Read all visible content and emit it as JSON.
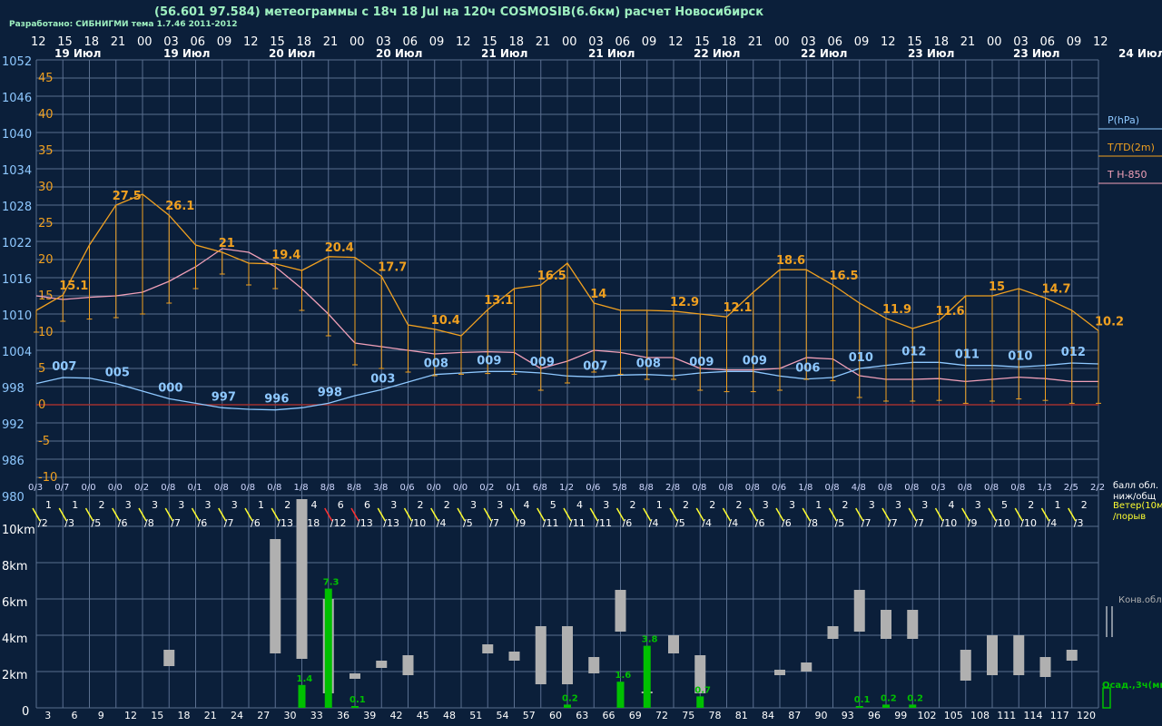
{
  "header": {
    "title": "(56.601 97.584) метеограммы с  18ч 18 Jul на 120ч COSMOSIB(6.6км) расчет Новосибирск",
    "credits": "Разработано: СИБНИГМИ тема 1.7.46 2011-2012"
  },
  "colors": {
    "pressure": "#8ec8ff",
    "temp": "#f0a020",
    "td": "#f0a0b8",
    "grid": "#5a6f8f",
    "precip": "#00c000",
    "cloud": "#b0b0b0",
    "wind": "#ffff30"
  },
  "chart_data": [
    {
      "type": "line",
      "title": "",
      "time_hours": [
        "12",
        "15",
        "18",
        "21",
        "00",
        "03",
        "06",
        "09",
        "12",
        "15",
        "18",
        "21",
        "00",
        "03",
        "06",
        "09",
        "12",
        "15",
        "18",
        "21",
        "00",
        "03",
        "06",
        "09",
        "12",
        "15",
        "18",
        "21",
        "00",
        "03",
        "06",
        "09",
        "12",
        "15",
        "18",
        "21",
        "00",
        "03",
        "06",
        "09",
        "12",
        "15",
        "18",
        "21",
        "00",
        "03",
        "06",
        "09",
        "12",
        "15",
        "18",
        "21",
        "00",
        "03",
        "06",
        "09",
        "12"
      ],
      "date_labels": [
        "19 Июл",
        "19 Июл",
        "20 Июл",
        "20 Июл",
        "21 Июл",
        "21 Июл",
        "22 Июл",
        "22 Июл",
        "23 Июл",
        "23 Июл",
        "24 Июл"
      ],
      "pressure_ticks": [
        "1052",
        "1046",
        "1040",
        "1034",
        "1028",
        "1022",
        "1016",
        "1010",
        "1004",
        "998",
        "992",
        "986",
        "980"
      ],
      "temp_ticks": [
        "45",
        "40",
        "35",
        "30",
        "25",
        "20",
        "15",
        "10",
        "5",
        "0",
        "-5",
        "-10"
      ],
      "legend": [
        "P(hPa)",
        "T/TD(2m)",
        "T H-850"
      ],
      "temp_ylim": [
        -10,
        45
      ],
      "pressure_ylim": [
        980,
        1052
      ],
      "temperature_points": [
        {
          "step": 0,
          "value": "",
          "t": 13
        },
        {
          "step": 1,
          "value": "15.1",
          "t": 15.1
        },
        {
          "step": 2,
          "value": "",
          "t": 22
        },
        {
          "step": 3,
          "value": "27.5",
          "t": 27.5
        },
        {
          "step": 4,
          "value": "",
          "t": 29
        },
        {
          "step": 5,
          "value": "26.1",
          "t": 26.1
        },
        {
          "step": 6,
          "value": "",
          "t": 22
        },
        {
          "step": 7,
          "value": "21",
          "t": 21
        },
        {
          "step": 8,
          "value": "",
          "t": 19.5
        },
        {
          "step": 9,
          "value": "19.4",
          "t": 19.4
        },
        {
          "step": 10,
          "value": "",
          "t": 18.5
        },
        {
          "step": 11,
          "value": "20.4",
          "t": 20.4
        },
        {
          "step": 12,
          "value": "",
          "t": 20.3
        },
        {
          "step": 13,
          "value": "17.7",
          "t": 17.7
        },
        {
          "step": 14,
          "value": "",
          "t": 11
        },
        {
          "step": 15,
          "value": "10.4",
          "t": 10.4
        },
        {
          "step": 16,
          "value": "",
          "t": 9.5
        },
        {
          "step": 17,
          "value": "13.1",
          "t": 13.1
        },
        {
          "step": 18,
          "value": "",
          "t": 16
        },
        {
          "step": 19,
          "value": "16.5",
          "t": 16.5
        },
        {
          "step": 20,
          "value": "",
          "t": 19.5
        },
        {
          "step": 21,
          "value": "14",
          "t": 14
        },
        {
          "step": 22,
          "value": "",
          "t": 13
        },
        {
          "step": 23,
          "value": "",
          "t": 13
        },
        {
          "step": 24,
          "value": "12.9",
          "t": 12.9
        },
        {
          "step": 25,
          "value": "",
          "t": 12.5
        },
        {
          "step": 26,
          "value": "12.1",
          "t": 12.1
        },
        {
          "step": 27,
          "value": "",
          "t": 15.5
        },
        {
          "step": 28,
          "value": "18.6",
          "t": 18.6
        },
        {
          "step": 29,
          "value": "",
          "t": 18.6
        },
        {
          "step": 30,
          "value": "16.5",
          "t": 16.5
        },
        {
          "step": 31,
          "value": "",
          "t": 14
        },
        {
          "step": 32,
          "value": "11.9",
          "t": 11.9
        },
        {
          "step": 33,
          "value": "",
          "t": 10.5
        },
        {
          "step": 34,
          "value": "11.6",
          "t": 11.6
        },
        {
          "step": 35,
          "value": "",
          "t": 15
        },
        {
          "step": 36,
          "value": "15",
          "t": 15
        },
        {
          "step": 37,
          "value": "",
          "t": 16
        },
        {
          "step": 38,
          "value": "14.7",
          "t": 14.7
        },
        {
          "step": 39,
          "value": "",
          "t": 13
        },
        {
          "step": 40,
          "value": "10.2",
          "t": 10.2
        }
      ],
      "temperature_850_td": [
        15,
        14.5,
        14.8,
        15,
        15.5,
        17,
        19,
        21.5,
        21,
        19,
        16,
        12.5,
        8.5,
        8,
        7.5,
        7,
        7.2,
        7.3,
        7.2,
        5,
        6,
        7.5,
        7.2,
        6.5,
        6.5,
        5,
        4.8,
        4.8,
        5,
        6.5,
        6.3,
        4,
        3.5,
        3.5,
        3.6,
        3.2,
        3.5,
        3.8,
        3.6,
        3.2,
        3.2
      ],
      "pressure_points": [
        {
          "step": 0,
          "value": "",
          "p": 1005
        },
        {
          "step": 1,
          "value": "007",
          "p": 1007
        },
        {
          "step": 2,
          "value": "",
          "p": 1006.8
        },
        {
          "step": 3,
          "value": "005",
          "p": 1005
        },
        {
          "step": 4,
          "value": "",
          "p": 1002.5
        },
        {
          "step": 5,
          "value": "000",
          "p": 1000
        },
        {
          "step": 6,
          "value": "",
          "p": 998.5
        },
        {
          "step": 7,
          "value": "997",
          "p": 997
        },
        {
          "step": 8,
          "value": "",
          "p": 996.5
        },
        {
          "step": 9,
          "value": "996",
          "p": 996.3
        },
        {
          "step": 10,
          "value": "",
          "p": 997
        },
        {
          "step": 11,
          "value": "998",
          "p": 998.5
        },
        {
          "step": 12,
          "value": "",
          "p": 1001
        },
        {
          "step": 13,
          "value": "003",
          "p": 1003
        },
        {
          "step": 14,
          "value": "",
          "p": 1005.5
        },
        {
          "step": 15,
          "value": "008",
          "p": 1008
        },
        {
          "step": 16,
          "value": "",
          "p": 1008.5
        },
        {
          "step": 17,
          "value": "009",
          "p": 1009
        },
        {
          "step": 18,
          "value": "",
          "p": 1009
        },
        {
          "step": 19,
          "value": "009",
          "p": 1008.5
        },
        {
          "step": 20,
          "value": "",
          "p": 1007.5
        },
        {
          "step": 21,
          "value": "007",
          "p": 1007.2
        },
        {
          "step": 22,
          "value": "",
          "p": 1007.8
        },
        {
          "step": 23,
          "value": "008",
          "p": 1008
        },
        {
          "step": 24,
          "value": "",
          "p": 1007.6
        },
        {
          "step": 25,
          "value": "009",
          "p": 1008.5
        },
        {
          "step": 26,
          "value": "",
          "p": 1009
        },
        {
          "step": 27,
          "value": "009",
          "p": 1009
        },
        {
          "step": 28,
          "value": "",
          "p": 1007.5
        },
        {
          "step": 29,
          "value": "006",
          "p": 1006.5
        },
        {
          "step": 30,
          "value": "",
          "p": 1007
        },
        {
          "step": 31,
          "value": "010",
          "p": 1010
        },
        {
          "step": 32,
          "value": "",
          "p": 1011
        },
        {
          "step": 33,
          "value": "012",
          "p": 1012
        },
        {
          "step": 34,
          "value": "",
          "p": 1012
        },
        {
          "step": 35,
          "value": "011",
          "p": 1011
        },
        {
          "step": 36,
          "value": "",
          "p": 1011
        },
        {
          "step": 37,
          "value": "010",
          "p": 1010.5
        },
        {
          "step": 38,
          "value": "",
          "p": 1011
        },
        {
          "step": 39,
          "value": "012",
          "p": 1011.8
        },
        {
          "step": 40,
          "value": "",
          "p": 1011.5
        }
      ],
      "precip_label_texts": [
        "1.4",
        "7.3",
        "0.1",
        "0.2",
        "1.6",
        "3.8",
        "0.7",
        "0.1",
        "0.2",
        "0.2"
      ]
    }
  ],
  "cloud_labels": [
    "0/3",
    "0/7",
    "0/0",
    "0/0",
    "0/2",
    "0/8",
    "0/1",
    "0/8",
    "0/8",
    "0/8",
    "1/8",
    "8/8",
    "8/8",
    "3/8",
    "0/6",
    "0/0",
    "0/0",
    "0/2",
    "0/1",
    "6/8",
    "1/2",
    "0/6",
    "5/8",
    "8/8",
    "2/8",
    "0/8",
    "0/8",
    "0/8",
    "0/6",
    "1/8",
    "0/8",
    "4/8",
    "0/8",
    "0/8",
    "0/3",
    "0/8",
    "0/8",
    "0/8",
    "1/3",
    "2/5",
    "2/2"
  ],
  "wind_top": [
    "1",
    "1",
    "2",
    "3",
    "3",
    "3",
    "3",
    "3",
    "1",
    "2",
    "4",
    "6",
    "6",
    "3",
    "2",
    "2",
    "3",
    "3",
    "4",
    "5",
    "4",
    "3",
    "2",
    "1",
    "2",
    "2",
    "2",
    "3",
    "3",
    "1",
    "2",
    "3",
    "3",
    "3",
    "4",
    "3",
    "5",
    "2",
    "1",
    "2"
  ],
  "wind_bottom": [
    "/2",
    "/3",
    "/5",
    "/6",
    "/8",
    "/7",
    "/6",
    "/7",
    "/6",
    "/13",
    "/18",
    "/12",
    "/13",
    "/13",
    "/10",
    "/4",
    "/5",
    "/7",
    "/9",
    "/11",
    "/11",
    "/11",
    "/6",
    "/4",
    "/5",
    "/4",
    "/4",
    "/6",
    "/6",
    "/8",
    "/5",
    "/7",
    "/7",
    "/7",
    "/10",
    "/9",
    "/10",
    "/10",
    "/4",
    "/3"
  ],
  "side_labels": {
    "cloud": "балл обл.\nниж/общ",
    "wind": "Ветер(10м)\n/порыв",
    "conv": "Конв.обл.",
    "precip": "Осад.,3ч(мм)"
  },
  "height_ticks": [
    "10km",
    "8km",
    "6km",
    "4km",
    "2km",
    "0"
  ],
  "lead_ticks": [
    "3",
    "6",
    "9",
    "12",
    "15",
    "18",
    "21",
    "24",
    "27",
    "30",
    "33",
    "36",
    "39",
    "42",
    "45",
    "48",
    "51",
    "54",
    "57",
    "60",
    "63",
    "66",
    "69",
    "72",
    "75",
    "78",
    "81",
    "84",
    "87",
    "90",
    "93",
    "96",
    "99",
    "102",
    "105",
    "108",
    "111",
    "114",
    "117",
    "120"
  ],
  "convective_clouds": [
    {
      "step": 5,
      "base": 2.3,
      "top": 3.2
    },
    {
      "step": 9,
      "base": 3.0,
      "top": 9.3
    },
    {
      "step": 10,
      "base": 2.7,
      "top": 11.5
    },
    {
      "step": 11,
      "base": 0.8,
      "top": 6.0
    },
    {
      "step": 12,
      "base": 1.6,
      "top": 1.9
    },
    {
      "step": 13,
      "base": 2.2,
      "top": 2.6
    },
    {
      "step": 14,
      "base": 1.8,
      "top": 2.9
    },
    {
      "step": 17,
      "base": 3.0,
      "top": 3.5
    },
    {
      "step": 18,
      "base": 2.6,
      "top": 3.1
    },
    {
      "step": 19,
      "base": 1.3,
      "top": 4.5
    },
    {
      "step": 20,
      "base": 1.3,
      "top": 4.5
    },
    {
      "step": 21,
      "base": 1.9,
      "top": 2.8
    },
    {
      "step": 22,
      "base": 4.2,
      "top": 6.5
    },
    {
      "step": 23,
      "base": 0.8,
      "top": 0.9
    },
    {
      "step": 24,
      "base": 3.0,
      "top": 4.0
    },
    {
      "step": 25,
      "base": 0.8,
      "top": 2.9
    },
    {
      "step": 28,
      "base": 1.8,
      "top": 2.1
    },
    {
      "step": 29,
      "base": 2.0,
      "top": 2.5
    },
    {
      "step": 30,
      "base": 3.8,
      "top": 4.5
    },
    {
      "step": 31,
      "base": 4.2,
      "top": 6.5
    },
    {
      "step": 32,
      "base": 3.8,
      "top": 5.4
    },
    {
      "step": 33,
      "base": 3.8,
      "top": 5.4
    },
    {
      "step": 35,
      "base": 1.5,
      "top": 3.2
    },
    {
      "step": 36,
      "base": 1.8,
      "top": 4.0
    },
    {
      "step": 37,
      "base": 1.8,
      "top": 4.0
    },
    {
      "step": 38,
      "base": 1.7,
      "top": 2.8
    },
    {
      "step": 39,
      "base": 2.6,
      "top": 3.2
    }
  ],
  "precipitation": [
    {
      "step": 10,
      "value": "1.4",
      "mm": 1.4
    },
    {
      "step": 11,
      "value": "7.3",
      "mm": 7.3
    },
    {
      "step": 12,
      "value": "0.1",
      "mm": 0.1
    },
    {
      "step": 20,
      "value": "0.2",
      "mm": 0.2
    },
    {
      "step": 22,
      "value": "1.6",
      "mm": 1.6
    },
    {
      "step": 23,
      "value": "3.8",
      "mm": 3.8
    },
    {
      "step": 25,
      "value": "0.7",
      "mm": 0.7
    },
    {
      "step": 31,
      "value": "0.1",
      "mm": 0.1
    },
    {
      "step": 32,
      "value": "0.2",
      "mm": 0.2
    },
    {
      "step": 33,
      "value": "0.2",
      "mm": 0.2
    }
  ]
}
